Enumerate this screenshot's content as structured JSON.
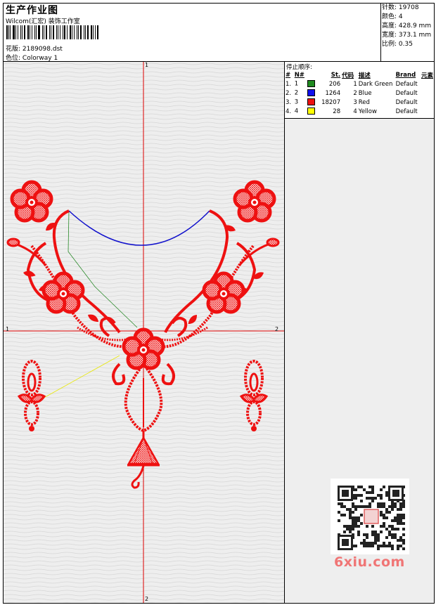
{
  "header": {
    "title": "生产作业图",
    "company": "Wilcom(汇宏) 装饰工作室",
    "design_label": "花版:",
    "design_value": "2189098.dst",
    "colorway_label": "色位:",
    "colorway_value": "Colorway 1"
  },
  "stats": [
    {
      "label": "针数:",
      "value": "19708"
    },
    {
      "label": "颜色:",
      "value": "4"
    },
    {
      "label": "高度:",
      "value": "428.9 mm"
    },
    {
      "label": "宽度:",
      "value": "373.1 mm"
    },
    {
      "label": "比例:",
      "value": "0.35"
    }
  ],
  "stop_sequence": {
    "title": "停止顺序:",
    "headers": [
      "#",
      "N#",
      "St.",
      "代码",
      "描述",
      "Brand",
      "元素"
    ],
    "rows": [
      {
        "num": "1.",
        "n": "1",
        "color": "#1f8a1f",
        "st": "206",
        "code": "1",
        "desc": "Dark Green",
        "brand": "Default"
      },
      {
        "num": "2.",
        "n": "2",
        "color": "#1010ee",
        "st": "1264",
        "code": "2",
        "desc": "Blue",
        "brand": "Default"
      },
      {
        "num": "3.",
        "n": "3",
        "color": "#ee1111",
        "st": "18207",
        "code": "3",
        "desc": "Red",
        "brand": "Default"
      },
      {
        "num": "4.",
        "n": "4",
        "color": "#ffff00",
        "st": "28",
        "code": "4",
        "desc": "Yellow",
        "brand": "Default"
      }
    ]
  },
  "axes": {
    "top": "1",
    "left": "1",
    "right": "2",
    "bottom": "2"
  },
  "watermark": {
    "text": "6xiu.com",
    "color": "#f07575"
  },
  "colors": {
    "red_stitch": "#ee1111",
    "blue_stitch": "#1010cc",
    "green_stitch": "#2a8a2a",
    "yellow_stitch": "#e8e800",
    "axis": "#dd0000"
  }
}
